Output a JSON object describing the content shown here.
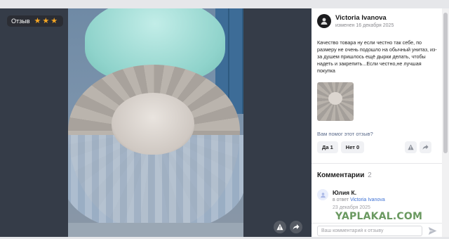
{
  "photo": {
    "rating_label": "Отзыв",
    "rating_value": 3,
    "stars": [
      "★",
      "★",
      "★"
    ]
  },
  "review": {
    "author": "Victoria Ivanova",
    "date": "изменен 16 декабря 2025",
    "text": "Качество товара ну если честно так себе, по размеру не очень подошло на обычный унитаз, из-за душем пришлось ещё дырки делать, чтобы надеть и закрепить...Если честно,не лучшая покупка",
    "helpful_question": "Вам помог этот отзыв?",
    "yes_label": "Да 1",
    "no_label": "Нет 0"
  },
  "comments": {
    "title": "Комментарии",
    "count": "2",
    "items": [
      {
        "name": "Юлия К.",
        "reply_prefix": "в ответ",
        "reply_to": "Victoria Ivanova",
        "date": "23 декабря 2025"
      }
    ],
    "input_placeholder": "Ваш комментарий к отзыву"
  },
  "watermark": "YAPLAKAL.COM",
  "colors": {
    "star": "#f5a623",
    "link": "#3b6fd4",
    "watermark": "#6a9960"
  }
}
